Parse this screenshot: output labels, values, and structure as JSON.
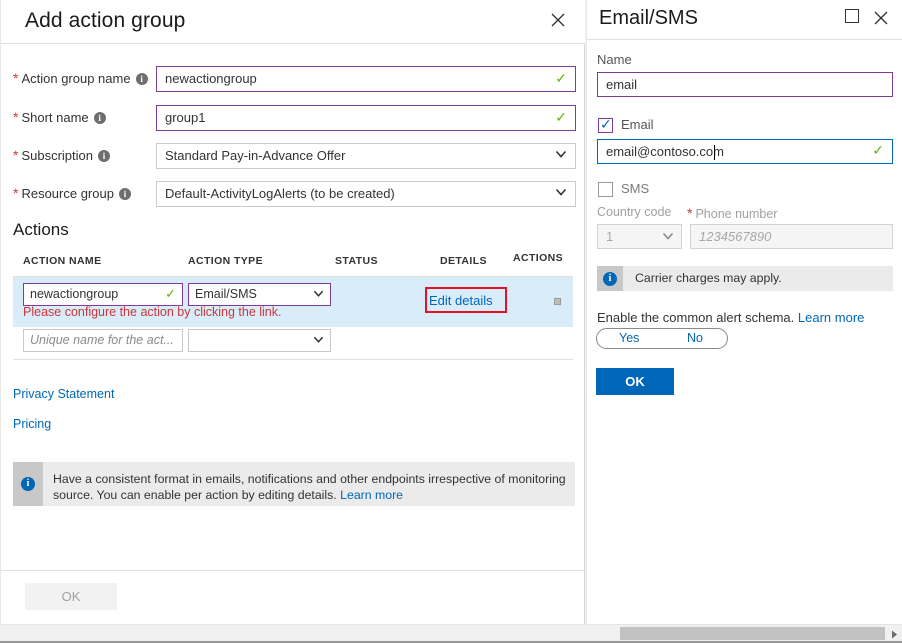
{
  "left_blade": {
    "title": "Add action group",
    "close_icon": "close-icon",
    "fields": [
      {
        "label": "Action group name",
        "value": "newactiongroup",
        "kind": "text",
        "required": true,
        "valid": true,
        "info_icon": "info-icon"
      },
      {
        "label": "Short name",
        "value": "group1",
        "kind": "text",
        "required": true,
        "valid": true,
        "info_icon": "info-icon"
      },
      {
        "label": "Subscription",
        "value": "Standard Pay-in-Advance Offer",
        "kind": "select",
        "required": true,
        "valid": false,
        "info_icon": "info-icon"
      },
      {
        "label": "Resource group",
        "value": "Default-ActivityLogAlerts (to be created)",
        "kind": "select",
        "required": true,
        "valid": false,
        "info_icon": "info-icon"
      }
    ],
    "actions_section_title": "Actions",
    "table": {
      "headers": [
        "ACTION NAME",
        "ACTION TYPE",
        "STATUS",
        "DETAILS",
        "ACTIONS"
      ],
      "rows": [
        {
          "action_name": "newactiongroup",
          "action_type": "Email/SMS",
          "status": "",
          "details_link": "Edit details",
          "error": "Please configure the action by clicking the link.",
          "highlighted": true
        },
        {
          "action_name_placeholder": "Unique name for the act...",
          "action_type": "",
          "status": "",
          "details_link": "",
          "error": "",
          "highlighted": false
        }
      ]
    },
    "links": [
      {
        "label": "Privacy Statement"
      },
      {
        "label": "Pricing"
      }
    ],
    "info_banner": {
      "icon": "info-icon",
      "text": "Have a consistent format in emails, notifications and other endpoints irrespective of monitoring source. You can enable per action by editing details.",
      "link": "Learn more"
    },
    "ok_button": "OK"
  },
  "right_blade": {
    "title": "Email/SMS",
    "maximize_icon": "maximize-icon",
    "close_icon": "close-icon",
    "name_label": "Name",
    "name_value": "email",
    "email_checkbox_label": "Email",
    "email_checked": true,
    "email_value": "email@contoso.com",
    "sms_checkbox_label": "SMS",
    "sms_checked": false,
    "country_code_label": "Country code",
    "country_code_value": "1",
    "phone_label": "Phone number",
    "phone_placeholder": "1234567890",
    "carrier_info": {
      "icon": "info-icon",
      "text": "Carrier charges may apply."
    },
    "common_schema_text": "Enable the common alert schema.",
    "common_schema_link": "Learn more",
    "toggle_yes": "Yes",
    "toggle_no": "No",
    "ok_button": "OK"
  },
  "scrollbar": {
    "arrow_icon": "chevron-right-icon"
  },
  "colors": {
    "accent": "#0067b8",
    "valid_border": "#7d3c98",
    "error": "#d13438",
    "highlight_row": "#d9ecf9",
    "red_box": "#e81123",
    "success_tick": "#5cb500"
  }
}
